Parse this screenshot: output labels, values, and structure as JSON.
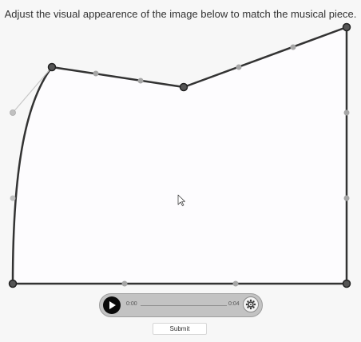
{
  "instruction": "Adjust the visual appearence of the image below to match the musical piece.",
  "player": {
    "current_time": "0:00",
    "total_time": "0:04",
    "progress": 0,
    "play_icon": "play-icon",
    "settings_icon": "gear-icon"
  },
  "submit_label": "Submit",
  "colors": {
    "shape_fill": "#fdfcfe",
    "shape_stroke": "#333333",
    "handle": "#b8b8b8"
  }
}
